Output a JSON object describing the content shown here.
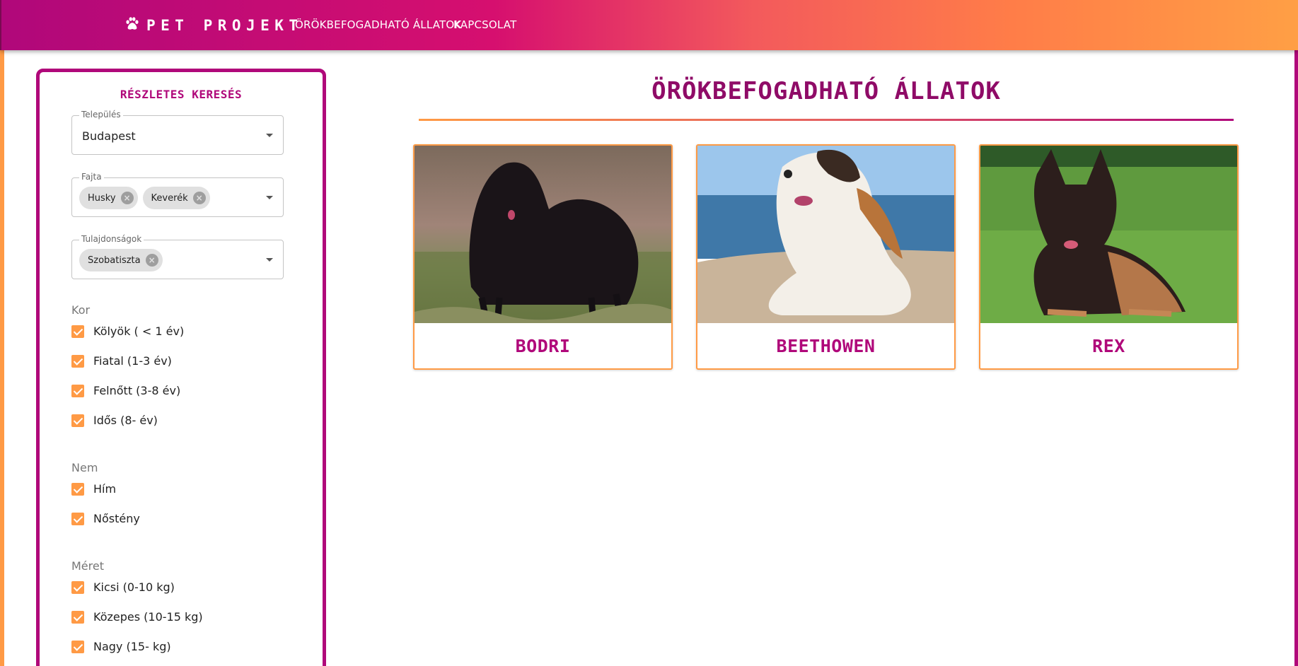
{
  "nav": {
    "brand": "PET PROJEKT",
    "brand_icon": "paw-icon",
    "links": [
      "ÖRÖKBEFOGADHATÓ ÁLLATOK",
      "KAPCSOLAT"
    ]
  },
  "colors": {
    "primary": "#b0087a",
    "accent": "#ff9a45",
    "title": "#8f0b67"
  },
  "sidebar": {
    "title": "RÉSZLETES KERESÉS",
    "location": {
      "label": "Település",
      "value": "Budapest"
    },
    "breed": {
      "label": "Fajta",
      "chips": [
        "Husky",
        "Keverék"
      ]
    },
    "traits": {
      "label": "Tulajdonságok",
      "chips": [
        "Szobatiszta"
      ]
    },
    "age": {
      "label": "Kor",
      "options": [
        "Kölyök ( < 1 év)",
        "Fiatal (1-3 év)",
        "Felnőtt (3-8 év)",
        "Idős (8- év)"
      ],
      "checked": [
        true,
        true,
        true,
        true
      ]
    },
    "sex": {
      "label": "Nem",
      "options": [
        "Hím",
        "Nőstény"
      ],
      "checked": [
        true,
        true
      ]
    },
    "size": {
      "label": "Méret",
      "options": [
        "Kicsi (0-10 kg)",
        "Közepes (10-15 kg)",
        "Nagy (15- kg)"
      ],
      "checked": [
        true,
        true,
        true
      ]
    }
  },
  "main": {
    "title": "ÖRÖKBEFOGADHATÓ ÁLLATOK",
    "animals": [
      {
        "name": "BODRI",
        "photo": "black corded puli dog on grass"
      },
      {
        "name": "BEETHOWEN",
        "photo": "saint bernard dog lying on beach"
      },
      {
        "name": "REX",
        "photo": "german shepherd puppy lying on lawn"
      }
    ]
  }
}
